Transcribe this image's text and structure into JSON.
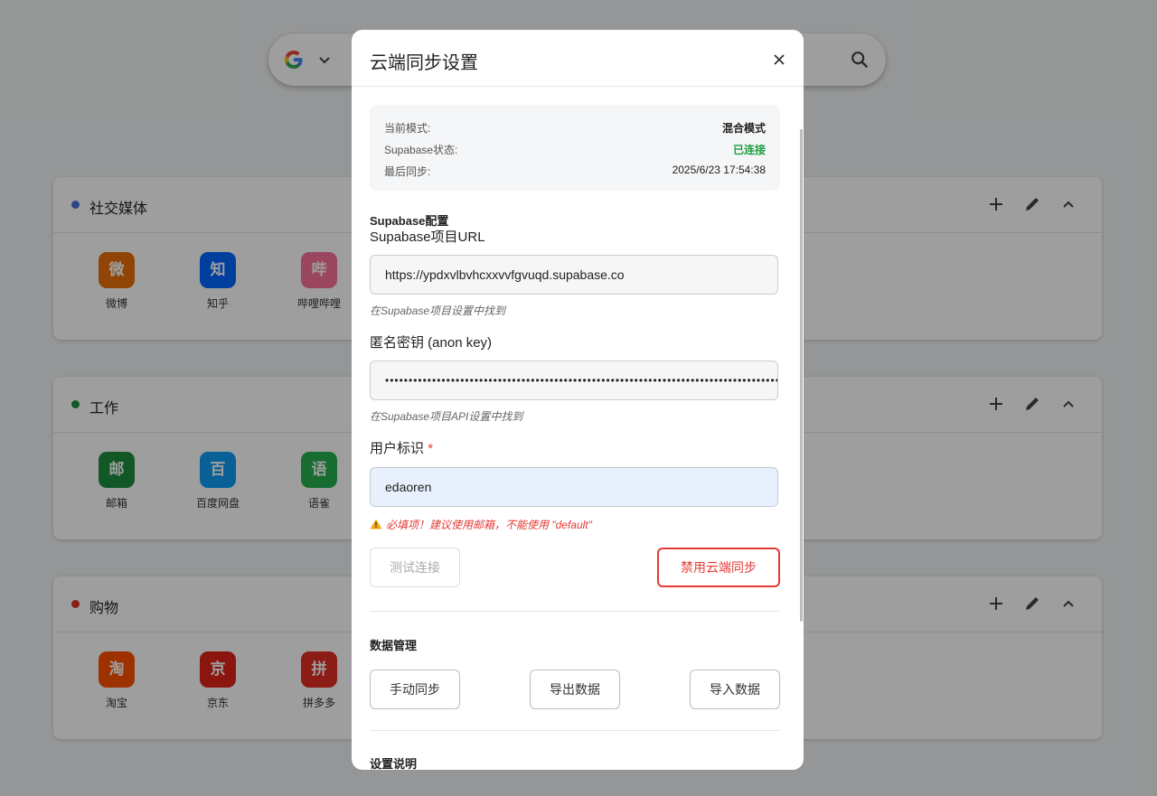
{
  "colors": {
    "social_dot": "#4a6fd6",
    "work_dot": "#1e8e3e",
    "shopping_dot": "#d93025",
    "connected": "#1e9e3e",
    "danger": "#e53935"
  },
  "search": {
    "engine_icon": "google-icon",
    "dropdown_icon": "chevron-down-icon",
    "search_icon": "search-icon"
  },
  "groups": [
    {
      "title": "社交媒体",
      "sites": [
        {
          "glyph": "微",
          "label": "微博",
          "color": "#e8700a"
        },
        {
          "glyph": "知",
          "label": "知乎",
          "color": "#0066ff"
        },
        {
          "glyph": "哔",
          "label": "哔哩哔哩",
          "color": "#fb7299"
        }
      ]
    },
    {
      "title": "工作",
      "sites": [
        {
          "glyph": "邮",
          "label": "邮箱",
          "color": "#1e8e3e"
        },
        {
          "glyph": "百",
          "label": "百度网盘",
          "color": "#0e9bf2"
        },
        {
          "glyph": "语",
          "label": "语雀",
          "color": "#26b14e"
        }
      ]
    },
    {
      "title": "购物",
      "sites": [
        {
          "glyph": "淘",
          "label": "淘宝",
          "color": "#ff5000"
        },
        {
          "glyph": "京",
          "label": "京东",
          "color": "#e1251b"
        },
        {
          "glyph": "拼",
          "label": "拼多多",
          "color": "#e02e24"
        }
      ]
    }
  ],
  "modal": {
    "title": "云端同步设置",
    "status": {
      "mode_label": "当前模式:",
      "mode_value": "混合模式",
      "supabase_label": "Supabase状态:",
      "supabase_value": "已连接",
      "last_sync_label": "最后同步:",
      "last_sync_value": "2025/6/23 17:54:38"
    },
    "config_heading": "Supabase配置",
    "url_label": "Supabase项目URL",
    "url_value": "https://ypdxvlbvhcxxvvfgvuqd.supabase.co",
    "url_hint": "在Supabase项目设置中找到",
    "key_label": "匿名密钥 (anon key)",
    "key_value": "••••••••••••••••••••••••••••••••••••••••••••••••••••••••••••••••••••••••••••••••••••",
    "key_hint": "在Supabase项目API设置中找到",
    "user_label": "用户标识",
    "required_mark": "*",
    "user_value": "edaoren",
    "user_warning": "必填项！建议使用邮箱，不能使用 \"default\"",
    "test_button": "测试连接",
    "disable_button": "禁用云端同步",
    "data_heading": "数据管理",
    "sync_button": "手动同步",
    "export_button": "导出数据",
    "import_button": "导入数据",
    "help_heading": "设置说明"
  }
}
